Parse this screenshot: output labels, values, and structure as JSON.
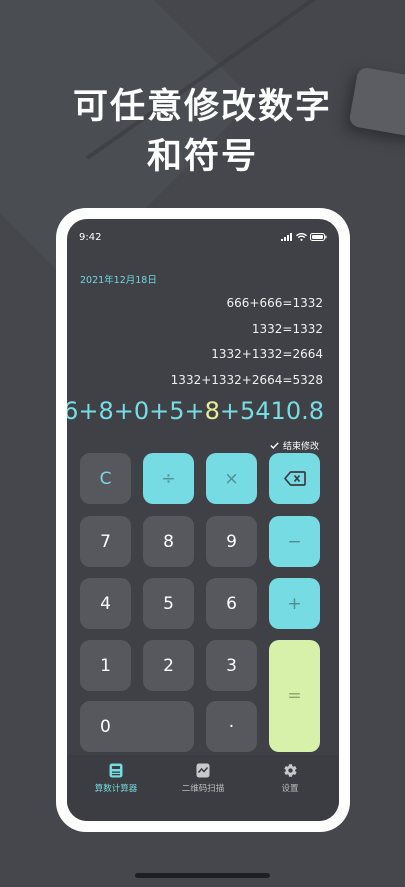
{
  "promo": {
    "line1": "可任意修改数字",
    "line2": "和符号"
  },
  "status_bar": {
    "time": "9:42"
  },
  "calculator": {
    "date": "2021年12月18日",
    "history": [
      "666+666=1332",
      "1332=1332",
      "1332+1332=2664",
      "1332+1332+2664=5328"
    ],
    "expression": {
      "before": "6+8+0+5+",
      "highlight": "8",
      "after": "+5410.8"
    },
    "finish_edit_label": "结束修改",
    "keys": {
      "clear": "C",
      "divide": "÷",
      "multiply": "×",
      "minus": "−",
      "plus": "+",
      "equals": "=",
      "dot": "·",
      "d7": "7",
      "d8": "8",
      "d9": "9",
      "d4": "4",
      "d5": "5",
      "d6": "6",
      "d1": "1",
      "d2": "2",
      "d3": "3",
      "d0": "0"
    }
  },
  "tabs": [
    {
      "label": "算数计算器",
      "active": true
    },
    {
      "label": "二维码扫描",
      "active": false
    },
    {
      "label": "设置",
      "active": false
    }
  ],
  "colors": {
    "background": "#45474d",
    "accent": "#76dbe2",
    "equals": "#d8f1aa",
    "highlight": "#e7ee9a"
  }
}
